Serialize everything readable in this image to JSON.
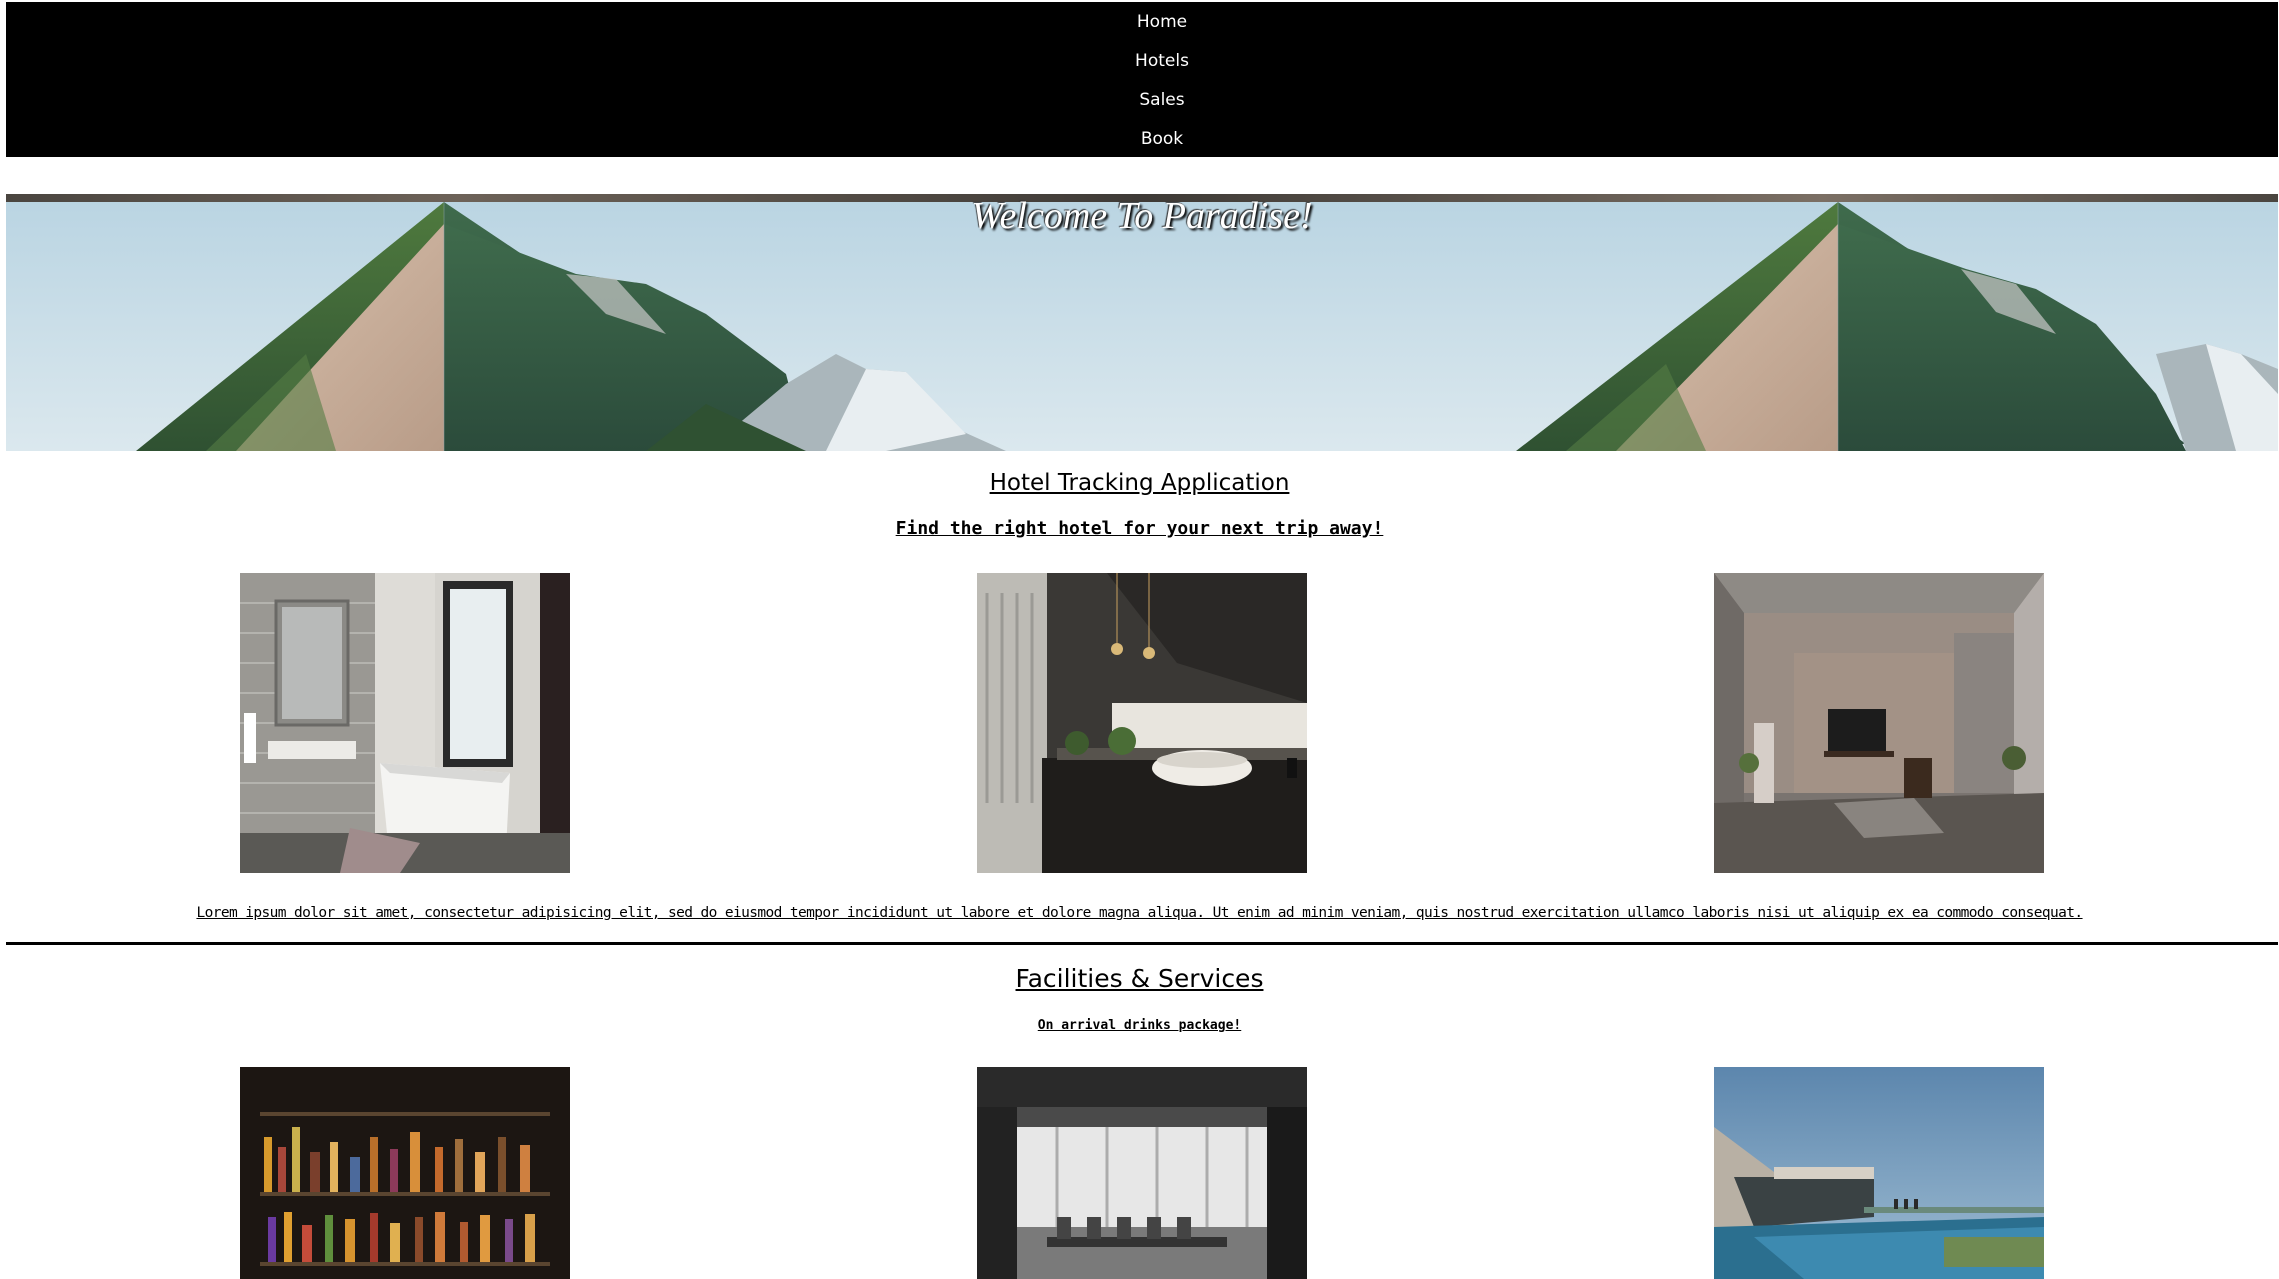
{
  "nav": {
    "items": [
      "Home",
      "Hotels",
      "Sales",
      "Book"
    ]
  },
  "hero": {
    "title": "Welcome To Paradise!"
  },
  "intro": {
    "title": "Hotel Tracking Application",
    "subtitle": "Find the right hotel for your next trip away!",
    "images": [
      {
        "name": "bathroom-image",
        "icon": "bathroom-photo"
      },
      {
        "name": "washbasin-image",
        "icon": "washbasin-photo"
      },
      {
        "name": "living-room-image",
        "icon": "living-room-photo"
      }
    ],
    "description": "Lorem ipsum dolor sit amet, consectetur adipisicing elit, sed do eiusmod tempor incididunt ut labore et dolore magna aliqua. Ut enim ad minim veniam, quis nostrud exercitation ullamco laboris nisi ut aliquip ex ea commodo consequat."
  },
  "facilities": {
    "title": "Facilities & Services",
    "subtitle": "On arrival drinks package!",
    "images": [
      {
        "name": "bar-image",
        "icon": "bar-photo"
      },
      {
        "name": "meeting-room-image",
        "icon": "meeting-room-photo"
      },
      {
        "name": "infinity-pool-image",
        "icon": "pool-photo"
      }
    ]
  },
  "colors": {
    "nav_background": "#000000",
    "nav_text": "#ffffff",
    "page_background": "#ffffff",
    "text": "#000000"
  }
}
